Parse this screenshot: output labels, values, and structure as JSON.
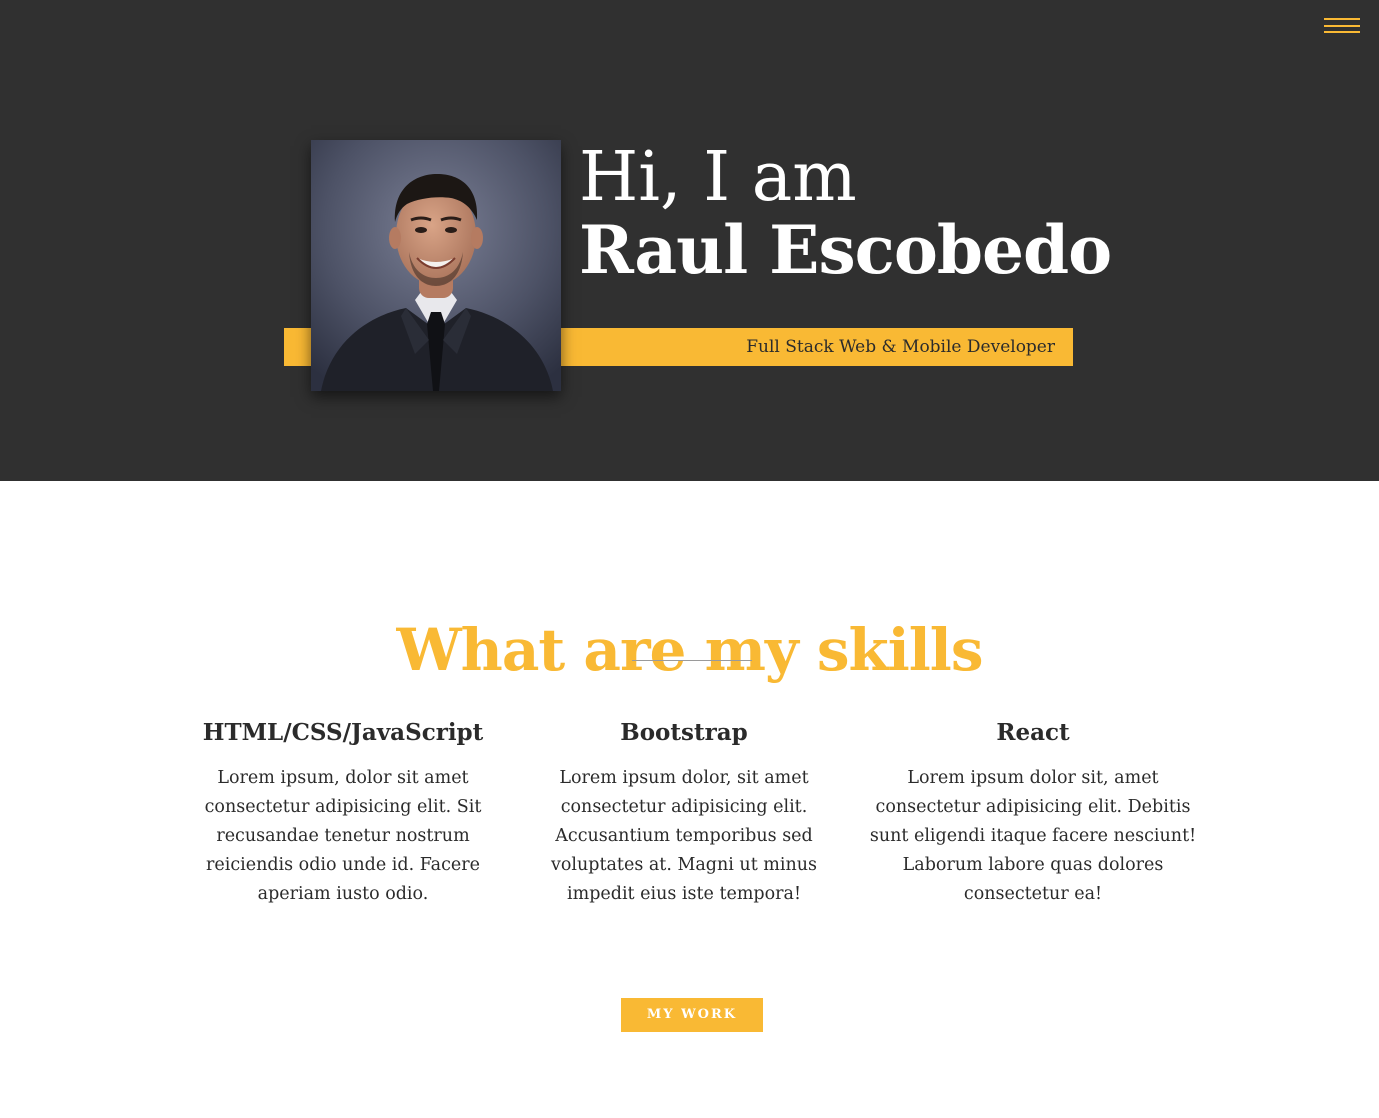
{
  "colors": {
    "accent": "#f9b934",
    "hero_background": "#303030",
    "text_dark": "#2b2b2b",
    "white": "#ffffff"
  },
  "nav": {
    "menu_icon": "hamburger-menu-icon"
  },
  "hero": {
    "greeting": "Hi, I am",
    "name": "Raul Escobedo",
    "subtitle": "Full Stack Web & Mobile Developer",
    "portrait": "headshot-photo"
  },
  "skills": {
    "title": "What are my skills",
    "items": [
      {
        "heading": "HTML/CSS/JavaScript",
        "text": "Lorem ipsum, dolor sit amet consectetur adipisicing elit. Sit recusandae tenetur nostrum reiciendis odio unde id. Facere aperiam iusto odio."
      },
      {
        "heading": "Bootstrap",
        "text": "Lorem ipsum dolor, sit amet consectetur adipisicing elit. Accusantium temporibus sed voluptates at. Magni ut minus impedit eius iste tempora!"
      },
      {
        "heading": "React",
        "text": "Lorem ipsum dolor sit, amet consectetur adipisicing elit. Debitis sunt eligendi itaque facere nesciunt! Laborum labore quas dolores consectetur ea!"
      }
    ],
    "button_label": "MY WORK"
  }
}
